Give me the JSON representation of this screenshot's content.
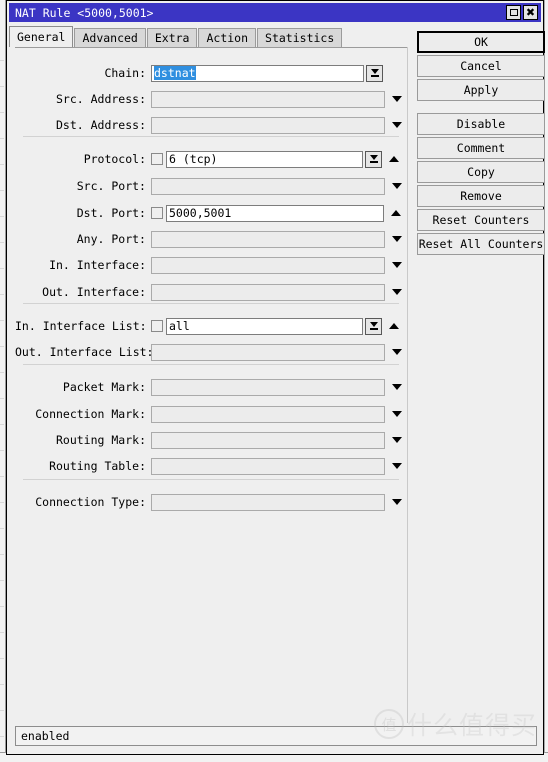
{
  "window": {
    "title": "NAT Rule <5000,5001>",
    "maximize_icon": "maximize-icon",
    "close_icon": "close-icon",
    "close_glyph": "✖"
  },
  "tabs": [
    {
      "label": "General",
      "active": true
    },
    {
      "label": "Advanced",
      "active": false
    },
    {
      "label": "Extra",
      "active": false
    },
    {
      "label": "Action",
      "active": false
    },
    {
      "label": "Statistics",
      "active": false
    }
  ],
  "fields": [
    {
      "label": "Chain:",
      "value": "dstnat",
      "selected": true,
      "enabled": true,
      "checkbox": false,
      "combo": true,
      "arrow": "none"
    },
    {
      "label": "Src. Address:",
      "value": "",
      "selected": false,
      "enabled": false,
      "checkbox": false,
      "combo": false,
      "arrow": "down"
    },
    {
      "label": "Dst. Address:",
      "value": "",
      "selected": false,
      "enabled": false,
      "checkbox": false,
      "combo": false,
      "arrow": "down"
    },
    {
      "label": "Protocol:",
      "value": "6 (tcp)",
      "selected": false,
      "enabled": true,
      "checkbox": true,
      "combo": true,
      "arrow": "up"
    },
    {
      "label": "Src. Port:",
      "value": "",
      "selected": false,
      "enabled": false,
      "checkbox": false,
      "combo": false,
      "arrow": "down"
    },
    {
      "label": "Dst. Port:",
      "value": "5000,5001",
      "selected": false,
      "enabled": true,
      "checkbox": true,
      "combo": false,
      "arrow": "up"
    },
    {
      "label": "Any. Port:",
      "value": "",
      "selected": false,
      "enabled": false,
      "checkbox": false,
      "combo": false,
      "arrow": "down"
    },
    {
      "label": "In. Interface:",
      "value": "",
      "selected": false,
      "enabled": false,
      "checkbox": false,
      "combo": false,
      "arrow": "down"
    },
    {
      "label": "Out. Interface:",
      "value": "",
      "selected": false,
      "enabled": false,
      "checkbox": false,
      "combo": false,
      "arrow": "down"
    },
    {
      "label": "In. Interface List:",
      "value": "all",
      "selected": false,
      "enabled": true,
      "checkbox": true,
      "combo": true,
      "arrow": "up"
    },
    {
      "label": "Out. Interface List:",
      "value": "",
      "selected": false,
      "enabled": false,
      "checkbox": false,
      "combo": false,
      "arrow": "down"
    },
    {
      "label": "Packet Mark:",
      "value": "",
      "selected": false,
      "enabled": false,
      "checkbox": false,
      "combo": false,
      "arrow": "down"
    },
    {
      "label": "Connection Mark:",
      "value": "",
      "selected": false,
      "enabled": false,
      "checkbox": false,
      "combo": false,
      "arrow": "down"
    },
    {
      "label": "Routing Mark:",
      "value": "",
      "selected": false,
      "enabled": false,
      "checkbox": false,
      "combo": false,
      "arrow": "down"
    },
    {
      "label": "Routing Table:",
      "value": "",
      "selected": false,
      "enabled": false,
      "checkbox": false,
      "combo": false,
      "arrow": "down"
    },
    {
      "label": "Connection Type:",
      "value": "",
      "selected": false,
      "enabled": false,
      "checkbox": false,
      "combo": false,
      "arrow": "down"
    }
  ],
  "buttons": [
    {
      "label": "OK",
      "primary": true,
      "gap": false
    },
    {
      "label": "Cancel",
      "primary": false,
      "gap": false
    },
    {
      "label": "Apply",
      "primary": false,
      "gap": false
    },
    {
      "label": "Disable",
      "primary": false,
      "gap": true
    },
    {
      "label": "Comment",
      "primary": false,
      "gap": false
    },
    {
      "label": "Copy",
      "primary": false,
      "gap": false
    },
    {
      "label": "Remove",
      "primary": false,
      "gap": false
    },
    {
      "label": "Reset Counters",
      "primary": false,
      "gap": false
    },
    {
      "label": "Reset All Counters",
      "primary": false,
      "gap": false
    }
  ],
  "statusbar": {
    "text": "enabled"
  },
  "watermark": {
    "badge": "值",
    "text": "什么值得买"
  },
  "colors": {
    "titlebar": "#3b35c4",
    "dialog_bg": "#efefef",
    "selection": "#2f8fe0",
    "field_disabled": "#ececec",
    "field_active": "#ffffff"
  }
}
